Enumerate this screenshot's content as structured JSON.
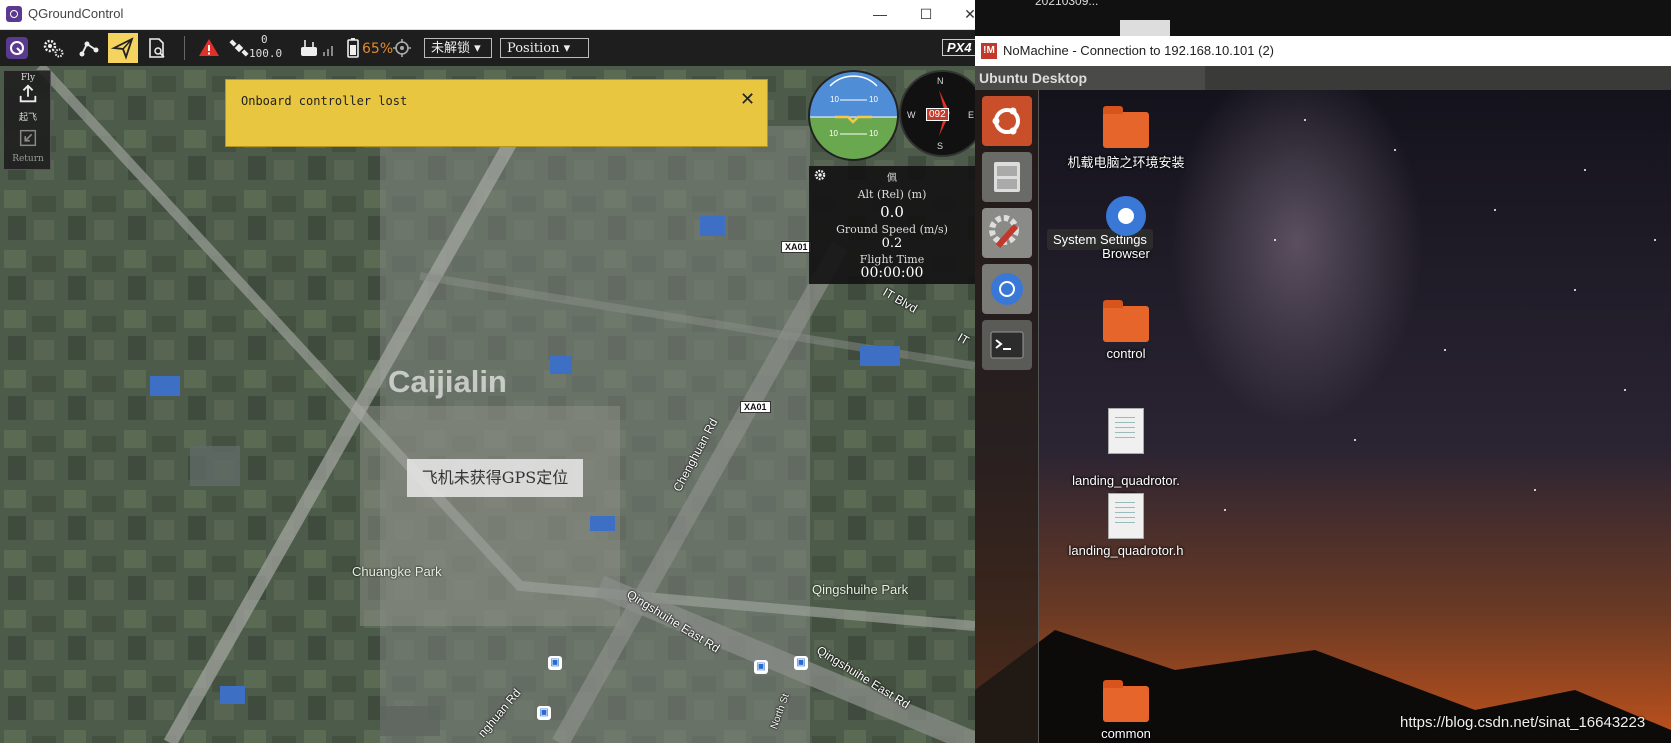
{
  "qgc": {
    "window_title": "QGroundControl",
    "window_controls": {
      "minimize": "—",
      "maximize": "☐",
      "close": "✕"
    },
    "toolbar": {
      "gps_count": "0",
      "gps_hdop": "100.0",
      "battery": "65%",
      "arm_state": "未解锁",
      "flight_mode": "Position",
      "brand": "PX4"
    },
    "left_rail": {
      "fly_label": "Fly",
      "takeoff_label": "起飞",
      "return_label": "Return"
    },
    "alert": {
      "message": "Onboard controller lost",
      "close": "✕"
    },
    "instruments": {
      "panel_tag": "佩",
      "compass_heading": "092",
      "alt_label": "Alt (Rel) (m)",
      "alt_value": "0.0",
      "speed_label": "Ground Speed (m/s)",
      "speed_value": "0.2",
      "time_label": "Flight Time",
      "time_value": "00:00:00"
    },
    "attitude": {
      "pitch_up": "10",
      "pitch_down": "10"
    },
    "compass_letters": {
      "n": "N",
      "e": "E",
      "s": "S",
      "w": "W"
    },
    "gps_message": "飞机未获得GPS定位",
    "map_labels": {
      "town": "Caijialin",
      "park1": "Chuangke Park",
      "park2": "Qingshuihe Park",
      "road1": "Chenghuan Rd",
      "road2": "Qingshuihe East Rd",
      "road3": "Qingshuihe East Rd",
      "road4": "IT Blvd",
      "road5": "IT",
      "road6": "nghuan Rd",
      "road7": "North St",
      "hwy1": "XA01",
      "hwy2": "XA01"
    }
  },
  "nomachine": {
    "topbar_text": "20210309...",
    "window_title": "NoMachine - Connection to 192.168.10.101 (2)",
    "ubuntu_bar_title": "Ubuntu Desktop",
    "tooltip": "System Settings",
    "desktop_icons": [
      {
        "label": "机载电脑之环境安装"
      },
      {
        "label": "Browser"
      },
      {
        "label": "control"
      },
      {
        "label": "landing_quadrotor.\ncpp"
      },
      {
        "label": "landing_quadrotor.h"
      },
      {
        "label": "common"
      }
    ]
  },
  "watermark": "https://blog.csdn.net/sinat_16643223"
}
